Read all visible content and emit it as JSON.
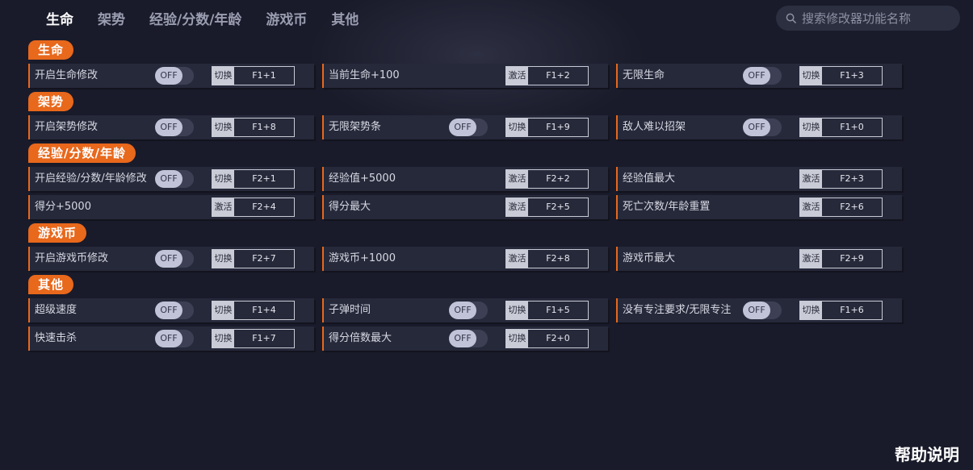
{
  "nav": {
    "tabs": [
      {
        "label": "生命"
      },
      {
        "label": "架势"
      },
      {
        "label": "经验/分数/年龄"
      },
      {
        "label": "游戏币"
      },
      {
        "label": "其他"
      }
    ]
  },
  "search": {
    "placeholder": "搜索修改器功能名称"
  },
  "help": {
    "label": "帮助说明"
  },
  "sections": [
    {
      "title": "生命",
      "rows": [
        [
          {
            "label": "开启生命修改",
            "toggle": "OFF",
            "kind": "切换",
            "key": "F1+1"
          },
          {
            "label": "当前生命+100",
            "kind": "激活",
            "key": "F1+2"
          },
          {
            "label": "无限生命",
            "toggle": "OFF",
            "kind": "切换",
            "key": "F1+3"
          }
        ]
      ]
    },
    {
      "title": "架势",
      "rows": [
        [
          {
            "label": "开启架势修改",
            "toggle": "OFF",
            "kind": "切换",
            "key": "F1+8"
          },
          {
            "label": "无限架势条",
            "toggle": "OFF",
            "kind": "切换",
            "key": "F1+9"
          },
          {
            "label": "敌人难以招架",
            "toggle": "OFF",
            "kind": "切换",
            "key": "F1+0"
          }
        ]
      ]
    },
    {
      "title": "经验/分数/年龄",
      "rows": [
        [
          {
            "label": "开启经验/分数/年龄修改",
            "toggle": "OFF",
            "kind": "切换",
            "key": "F2+1"
          },
          {
            "label": "经验值+5000",
            "kind": "激活",
            "key": "F2+2"
          },
          {
            "label": "经验值最大",
            "kind": "激活",
            "key": "F2+3"
          }
        ],
        [
          {
            "label": "得分+5000",
            "kind": "激活",
            "key": "F2+4"
          },
          {
            "label": "得分最大",
            "kind": "激活",
            "key": "F2+5"
          },
          {
            "label": "死亡次数/年龄重置",
            "kind": "激活",
            "key": "F2+6"
          }
        ]
      ]
    },
    {
      "title": "游戏币",
      "rows": [
        [
          {
            "label": "开启游戏币修改",
            "toggle": "OFF",
            "kind": "切换",
            "key": "F2+7"
          },
          {
            "label": "游戏币+1000",
            "kind": "激活",
            "key": "F2+8"
          },
          {
            "label": "游戏币最大",
            "kind": "激活",
            "key": "F2+9"
          }
        ]
      ]
    },
    {
      "title": "其他",
      "rows": [
        [
          {
            "label": "超级速度",
            "toggle": "OFF",
            "kind": "切换",
            "key": "F1+4"
          },
          {
            "label": "子弹时间",
            "toggle": "OFF",
            "kind": "切换",
            "key": "F1+5"
          },
          {
            "label": "没有专注要求/无限专注",
            "toggle": "OFF",
            "kind": "切换",
            "key": "F1+6"
          }
        ],
        [
          {
            "label": "快速击杀",
            "toggle": "OFF",
            "kind": "切换",
            "key": "F1+7"
          },
          {
            "label": "得分倍数最大",
            "toggle": "OFF",
            "kind": "切换",
            "key": "F2+0"
          }
        ]
      ]
    }
  ]
}
